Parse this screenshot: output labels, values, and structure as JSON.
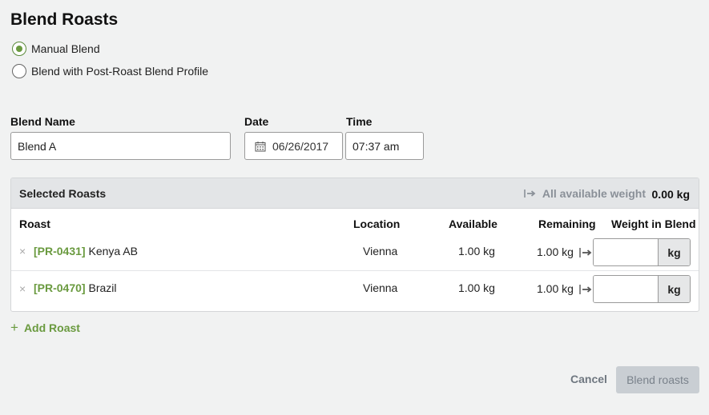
{
  "page": {
    "title": "Blend Roasts"
  },
  "mode": {
    "options": [
      {
        "label": "Manual Blend",
        "checked": true
      },
      {
        "label": "Blend with Post-Roast Blend Profile",
        "checked": false
      }
    ]
  },
  "form": {
    "blend_name": {
      "label": "Blend Name",
      "value": "Blend A"
    },
    "date": {
      "label": "Date",
      "value": "06/26/2017",
      "icon": "calendar-icon"
    },
    "time": {
      "label": "Time",
      "value": "07:37 am"
    }
  },
  "panel": {
    "title": "Selected Roasts",
    "all_available_label": "All available weight",
    "total_weight": "0.00 kg",
    "columns": {
      "roast": "Roast",
      "location": "Location",
      "available": "Available",
      "remaining": "Remaining",
      "weight": "Weight in Blend"
    },
    "rows": [
      {
        "remove": "×",
        "code": "[PR-0431]",
        "name": "Kenya AB",
        "location": "Vienna",
        "available": "1.00 kg",
        "remaining": "1.00 kg",
        "weight": "",
        "unit": "kg"
      },
      {
        "remove": "×",
        "code": "[PR-0470]",
        "name": "Brazil",
        "location": "Vienna",
        "available": "1.00 kg",
        "remaining": "1.00 kg",
        "weight": "",
        "unit": "kg"
      }
    ]
  },
  "actions": {
    "add_roast": "Add Roast",
    "add_roast_icon": "+",
    "cancel": "Cancel",
    "submit": "Blend roasts"
  },
  "colors": {
    "accent_green": "#6a9a3f",
    "disabled_button": "#c9ced3",
    "header_bg": "#e3e5e7"
  }
}
